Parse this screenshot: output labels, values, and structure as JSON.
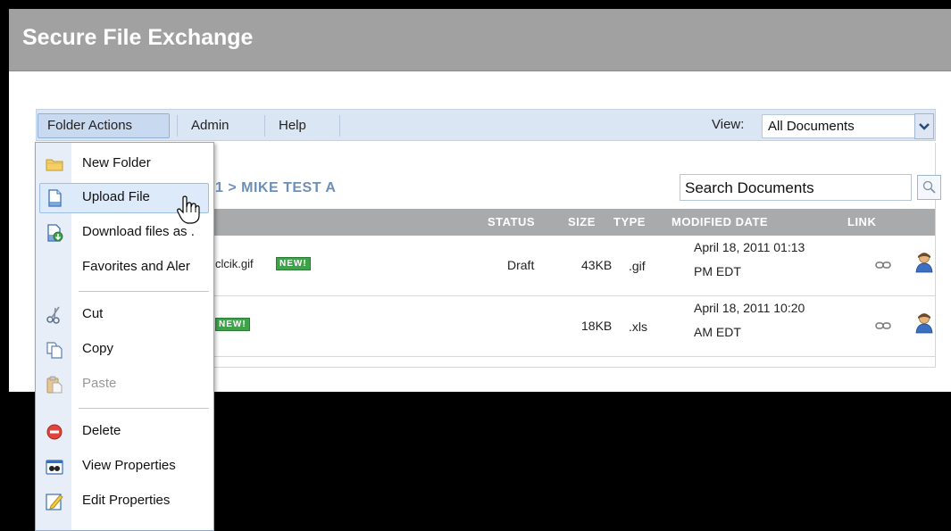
{
  "app": {
    "title": "Secure File Exchange"
  },
  "menubar": {
    "items": [
      "Folder Actions",
      "Admin",
      "Help"
    ],
    "view_label": "View:",
    "view_value": "All Documents"
  },
  "breadcrumb": "1 > MIKE TEST A",
  "search": {
    "value": "Search Documents"
  },
  "table": {
    "headers": [
      "STATUS",
      "SIZE",
      "TYPE",
      "MODIFIED DATE",
      "LINK"
    ],
    "rows": [
      {
        "name_fragment": "clcik.gif",
        "badge": "NEW!",
        "status": "Draft",
        "size": "43KB",
        "type": ".gif",
        "date_line1": "April 18, 2011 01:13",
        "date_line2": "PM EDT"
      },
      {
        "name_fragment": "",
        "badge": "NEW!",
        "status": "",
        "size": "18KB",
        "type": ".xls",
        "date_line1": "April 18, 2011 10:20",
        "date_line2": "AM EDT"
      }
    ]
  },
  "dropdown": {
    "items": [
      {
        "label": "New Folder",
        "icon": "folder-icon"
      },
      {
        "label": "Upload File",
        "icon": "document-icon"
      },
      {
        "label": "Download files as .",
        "icon": "download-icon"
      },
      {
        "label": "Favorites and Aler",
        "icon": ""
      },
      {
        "label": "Cut",
        "icon": "scissors-icon"
      },
      {
        "label": "Copy",
        "icon": "copy-icon"
      },
      {
        "label": "Paste",
        "icon": "paste-icon"
      },
      {
        "label": "Delete",
        "icon": "delete-icon"
      },
      {
        "label": "View Properties",
        "icon": "properties-icon"
      },
      {
        "label": "Edit Properties",
        "icon": "edit-icon"
      }
    ]
  },
  "colors": {
    "titlebar": "#a1a1a1",
    "menubar": "#dbe6f4",
    "breadcrumb": "#6e8fb4",
    "table_header": "#a9aaab",
    "new_badge": "#3ea24a"
  }
}
